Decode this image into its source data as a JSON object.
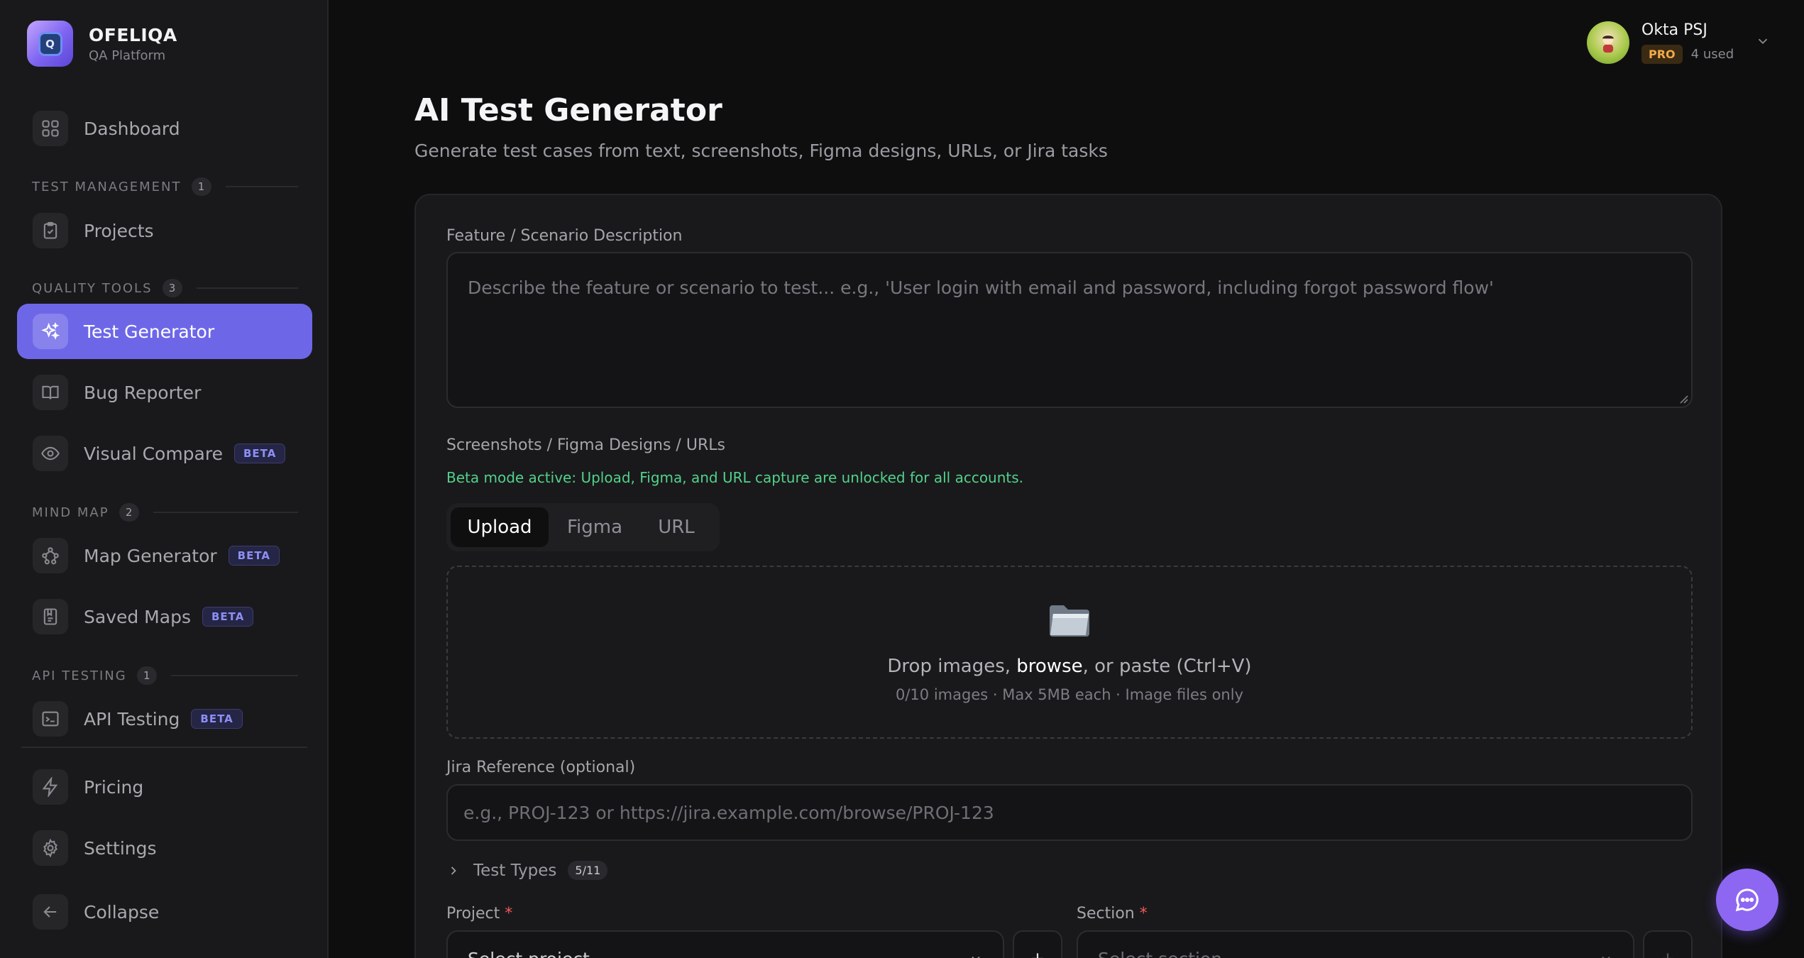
{
  "brand": {
    "name": "OFELIQA",
    "subtitle": "QA Platform",
    "logo_letter": "Q"
  },
  "sidebar": {
    "dashboard": {
      "label": "Dashboard",
      "icon": "grid-icon"
    },
    "sections": {
      "test_management": {
        "title": "TEST MANAGEMENT",
        "count": "1"
      },
      "quality_tools": {
        "title": "QUALITY TOOLS",
        "count": "3"
      },
      "mind_map": {
        "title": "MIND MAP",
        "count": "2"
      },
      "api_testing": {
        "title": "API TESTING",
        "count": "1"
      }
    },
    "items": {
      "projects": {
        "label": "Projects",
        "icon": "clipboard-check-icon"
      },
      "test_generator": {
        "label": "Test Generator",
        "icon": "sparkles-icon",
        "active": true
      },
      "bug_reporter": {
        "label": "Bug Reporter",
        "icon": "book-open-icon"
      },
      "visual_compare": {
        "label": "Visual Compare",
        "badge": "BETA",
        "icon": "eye-icon"
      },
      "map_generator": {
        "label": "Map Generator",
        "badge": "BETA",
        "icon": "network-icon"
      },
      "saved_maps": {
        "label": "Saved Maps",
        "badge": "BETA",
        "icon": "bookmark-list-icon"
      },
      "api_testing": {
        "label": "API Testing",
        "badge": "BETA",
        "icon": "terminal-icon"
      },
      "pricing": {
        "label": "Pricing",
        "icon": "lightning-icon"
      },
      "settings": {
        "label": "Settings",
        "icon": "gear-icon"
      },
      "collapse": {
        "label": "Collapse",
        "icon": "arrow-left-icon"
      }
    }
  },
  "user": {
    "name": "Okta PSJ",
    "plan": "PRO",
    "usage": "4 used"
  },
  "page": {
    "title": "AI Test Generator",
    "subtitle": "Generate test cases from text, screenshots, Figma designs, URLs, or Jira tasks"
  },
  "form": {
    "description_label": "Feature / Scenario Description",
    "description_placeholder": "Describe the feature or scenario to test... e.g., 'User login with email and password, including forgot password flow'",
    "media_label": "Screenshots / Figma Designs / URLs",
    "beta_note": "Beta mode active: Upload, Figma, and URL capture are unlocked for all accounts.",
    "tabs": [
      "Upload",
      "Figma",
      "URL"
    ],
    "active_tab": "Upload",
    "dropzone": {
      "text_before": "Drop images, ",
      "browse": "browse",
      "text_after": ", or paste (Ctrl+V)",
      "hint": "0/10 images · Max 5MB each · Image files only"
    },
    "jira_label": "Jira Reference (optional)",
    "jira_placeholder": "e.g., PROJ-123 or https://jira.example.com/browse/PROJ-123",
    "test_types_label": "Test Types",
    "test_types_count": "5/11",
    "project_label": "Project",
    "project_placeholder": "Select project",
    "section_label": "Section",
    "section_placeholder": "Select section",
    "required_mark": "*"
  },
  "colors": {
    "accent": "#6d67e8",
    "success": "#52d18b",
    "required": "#ef5a5a",
    "pro": "#f0a94a",
    "fab": "#8d67f2"
  }
}
